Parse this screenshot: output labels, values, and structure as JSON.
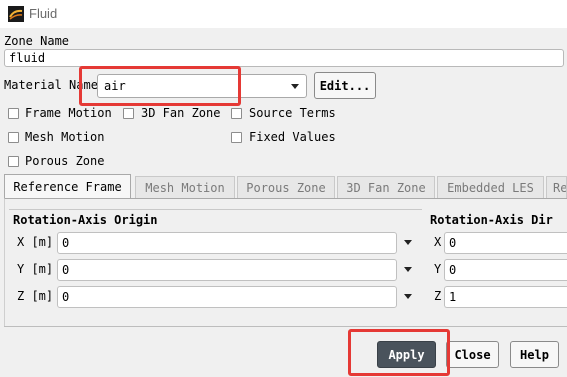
{
  "window": {
    "title": "Fluid"
  },
  "zone_name": {
    "label": "Zone Name",
    "value": "fluid"
  },
  "material": {
    "label": "Material Name",
    "value": "air",
    "edit_label": "Edit..."
  },
  "options": {
    "frame_motion": "Frame Motion",
    "fan_zone_3d": "3D Fan Zone",
    "source_terms": "Source Terms",
    "mesh_motion": "Mesh Motion",
    "fixed_values": "Fixed Values",
    "porous_zone": "Porous Zone"
  },
  "tabs": [
    "Reference Frame",
    "Mesh Motion",
    "Porous Zone",
    "3D Fan Zone",
    "Embedded LES",
    "Re"
  ],
  "reference_frame": {
    "origin": {
      "title": "Rotation-Axis Origin",
      "x_label": "X [m]",
      "x_value": "0",
      "y_label": "Y [m]",
      "y_value": "0",
      "z_label": "Z [m]",
      "z_value": "0"
    },
    "direction": {
      "title": "Rotation-Axis Dir",
      "x_label": "X",
      "x_value": "0",
      "y_label": "Y",
      "y_value": "0",
      "z_label": "Z",
      "z_value": "1"
    }
  },
  "buttons": {
    "apply": "Apply",
    "close": "Close",
    "help": "Help"
  },
  "colors": {
    "highlight": "#e53935",
    "apply_bg": "#4a535c"
  }
}
